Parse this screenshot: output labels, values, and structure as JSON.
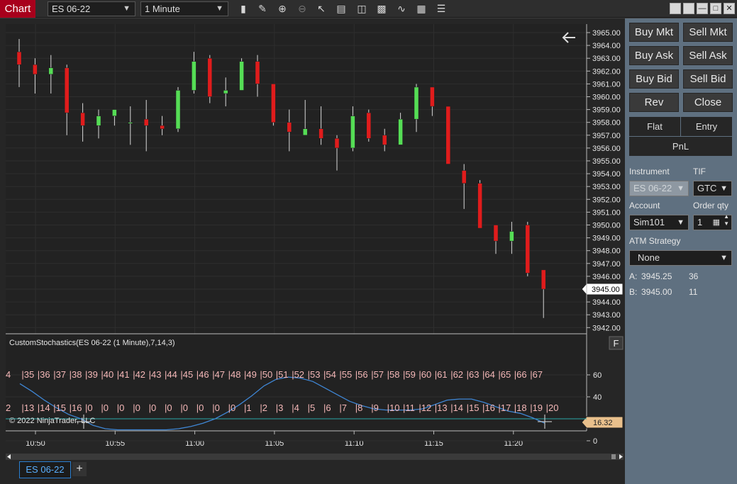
{
  "topbar": {
    "chart_label": "Chart",
    "instrument": "ES 06-22",
    "interval": "1 Minute"
  },
  "price_axis": {
    "labels": [
      "3965.00",
      "3964.00",
      "3963.00",
      "3962.00",
      "3961.00",
      "3960.00",
      "3959.00",
      "3958.00",
      "3957.00",
      "3956.00",
      "3955.00",
      "3954.00",
      "3953.00",
      "3952.00",
      "3951.00",
      "3950.00",
      "3949.00",
      "3948.00",
      "3947.00",
      "3946.00",
      "3945.00",
      "3944.00",
      "3943.00",
      "3942.00"
    ],
    "current": "3945.00"
  },
  "time_axis": [
    "10:50",
    "10:55",
    "11:00",
    "11:05",
    "11:10",
    "11:15",
    "11:20"
  ],
  "candles": [
    {
      "o": 3963.5,
      "h": 3964.5,
      "l": 3960.75,
      "c": 3962.5
    },
    {
      "o": 3962.5,
      "h": 3963.0,
      "l": 3960.25,
      "c": 3961.75
    },
    {
      "o": 3961.75,
      "h": 3963.25,
      "l": 3960.25,
      "c": 3962.25
    },
    {
      "o": 3962.25,
      "h": 3962.5,
      "l": 3957.0,
      "c": 3958.75
    },
    {
      "o": 3958.75,
      "h": 3959.5,
      "l": 3956.5,
      "c": 3957.75
    },
    {
      "o": 3957.75,
      "h": 3959.0,
      "l": 3956.75,
      "c": 3958.5
    },
    {
      "o": 3958.5,
      "h": 3959.0,
      "l": 3957.75,
      "c": 3959.0
    },
    {
      "o": 3958.0,
      "h": 3959.25,
      "l": 3956.25,
      "c": 3958.0
    },
    {
      "o": 3958.25,
      "h": 3959.75,
      "l": 3955.75,
      "c": 3957.75
    },
    {
      "o": 3957.75,
      "h": 3958.5,
      "l": 3957.0,
      "c": 3957.5
    },
    {
      "o": 3957.5,
      "h": 3960.75,
      "l": 3957.25,
      "c": 3960.5
    },
    {
      "o": 3960.5,
      "h": 3963.5,
      "l": 3960.25,
      "c": 3962.75
    },
    {
      "o": 3963.0,
      "h": 3963.25,
      "l": 3959.5,
      "c": 3960.0
    },
    {
      "o": 3960.25,
      "h": 3961.5,
      "l": 3959.25,
      "c": 3960.5
    },
    {
      "o": 3960.5,
      "h": 3963.0,
      "l": 3960.5,
      "c": 3962.75
    },
    {
      "o": 3962.75,
      "h": 3963.25,
      "l": 3960.0,
      "c": 3961.0
    },
    {
      "o": 3961.0,
      "h": 3961.0,
      "l": 3957.75,
      "c": 3958.0
    },
    {
      "o": 3958.0,
      "h": 3959.0,
      "l": 3955.75,
      "c": 3957.25
    },
    {
      "o": 3957.0,
      "h": 3959.75,
      "l": 3957.0,
      "c": 3957.5
    },
    {
      "o": 3957.5,
      "h": 3959.25,
      "l": 3956.25,
      "c": 3956.75
    },
    {
      "o": 3956.75,
      "h": 3957.0,
      "l": 3954.25,
      "c": 3956.0
    },
    {
      "o": 3956.0,
      "h": 3959.25,
      "l": 3955.75,
      "c": 3958.5
    },
    {
      "o": 3958.75,
      "h": 3959.0,
      "l": 3956.5,
      "c": 3956.75
    },
    {
      "o": 3957.0,
      "h": 3957.5,
      "l": 3955.75,
      "c": 3956.25
    },
    {
      "o": 3956.25,
      "h": 3958.75,
      "l": 3956.25,
      "c": 3958.25
    },
    {
      "o": 3958.25,
      "h": 3961.0,
      "l": 3957.25,
      "c": 3960.75
    },
    {
      "o": 3960.75,
      "h": 3960.75,
      "l": 3958.5,
      "c": 3959.25
    },
    {
      "o": 3959.25,
      "h": 3959.25,
      "l": 3954.75,
      "c": 3954.75
    },
    {
      "o": 3954.25,
      "h": 3954.75,
      "l": 3951.25,
      "c": 3953.25
    },
    {
      "o": 3953.25,
      "h": 3953.5,
      "l": 3949.75,
      "c": 3949.75
    },
    {
      "o": 3950.0,
      "h": 3950.0,
      "l": 3947.75,
      "c": 3948.75
    },
    {
      "o": 3948.75,
      "h": 3950.25,
      "l": 3947.75,
      "c": 3949.5
    },
    {
      "o": 3950.0,
      "h": 3950.25,
      "l": 3946.0,
      "c": 3946.25
    },
    {
      "o": 3946.5,
      "h": 3946.5,
      "l": 3942.75,
      "c": 3945.0
    }
  ],
  "indicator": {
    "title": "CustomStochastics(ES 06-22 (1 Minute),7,14,3)",
    "row1": [
      "4",
      "|35",
      "|36",
      "|37",
      "|38",
      "|39",
      "|40",
      "|41",
      "|42",
      "|43",
      "|44",
      "|45",
      "|46",
      "|47",
      "|48",
      "|49",
      "|50",
      "|51",
      "|52",
      "|53",
      "|54",
      "|55",
      "|56",
      "|57",
      "|58",
      "|59",
      "|60",
      "|61",
      "|62",
      "|63",
      "|64",
      "|65",
      "|66",
      "|67"
    ],
    "row2": [
      "2",
      "|13",
      "|14",
      "|15",
      "|16",
      "|0",
      "|0",
      "|0",
      "|0",
      "|0",
      "|0",
      "|0",
      "|0",
      "|0",
      "|0",
      "|1",
      "|2",
      "|3",
      "|4",
      "|5",
      "|6",
      "|7",
      "|8",
      "|9",
      "|10",
      "|11",
      "|12",
      "|13",
      "|14",
      "|15",
      "|16",
      "|17",
      "|18",
      "|19",
      "|20"
    ],
    "axis_labels": [
      "60",
      "40",
      "20",
      "0"
    ],
    "value_label": "16.32",
    "level": 20,
    "stoch_values": [
      52,
      45,
      37,
      30,
      24,
      20,
      14,
      11,
      10,
      10,
      10,
      10,
      10,
      11,
      13,
      16,
      20,
      26,
      33,
      41,
      50,
      56,
      58,
      57,
      54,
      48,
      42,
      36,
      32,
      29,
      28,
      28,
      28,
      29,
      33,
      37,
      38,
      38,
      35,
      31,
      27,
      25,
      21,
      16
    ],
    "f_button": "F",
    "copyright": "© 2022 NinjaTrader, LLC"
  },
  "panel": {
    "buttons": [
      [
        "Buy Mkt",
        "Sell Mkt"
      ],
      [
        "Buy Ask",
        "Sell Ask"
      ],
      [
        "Buy Bid",
        "Sell Bid"
      ],
      [
        "Rev",
        "Close"
      ]
    ],
    "flat": "Flat",
    "entry": "Entry",
    "pnl": "PnL",
    "instrument_label": "Instrument",
    "tif_label": "TIF",
    "instrument_value": "ES 06-22",
    "tif_value": "GTC",
    "account_label": "Account",
    "orderqty_label": "Order qty",
    "account_value": "Sim101",
    "orderqty_value": "1",
    "atm_label": "ATM Strategy",
    "atm_value": "None",
    "ask_label": "A:",
    "ask_price": "3945.25",
    "ask_size": "36",
    "bid_label": "B:",
    "bid_price": "3945.00",
    "bid_size": "11"
  },
  "tabs": {
    "active": "ES 06-22",
    "add": "+"
  },
  "colors": {
    "up": "#55dd55",
    "down": "#e01c1c",
    "stoch_line": "#3f86d4",
    "level_line": "#2aa8a8",
    "current_tag": "#ffffff",
    "value_tag": "#e9c08c"
  }
}
